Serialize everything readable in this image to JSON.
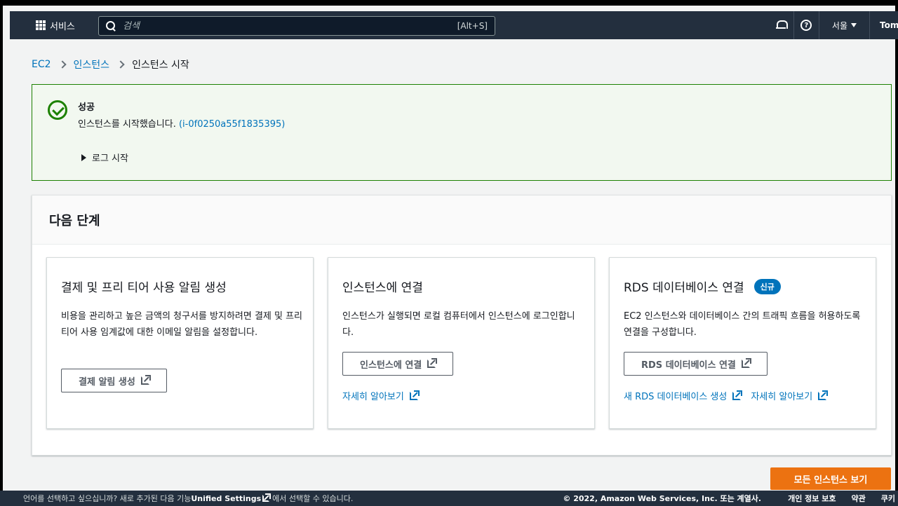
{
  "nav": {
    "services_label": "서비스",
    "search_placeholder": "검색",
    "search_shortcut": "[Alt+S]",
    "region": "서울",
    "user": "Tom"
  },
  "breadcrumb": {
    "items": [
      "EC2",
      "인스턴스",
      "인스턴스 시작"
    ]
  },
  "flash": {
    "title": "성공",
    "message": "인스턴스를 시작했습니다. ",
    "instance_link": "(i-0f0250a55f1835395)",
    "log_toggle": "로그 시작"
  },
  "next_steps": {
    "title": "다음 단계",
    "cards": [
      {
        "title": "결제 및 프리 티어 사용 알림 생성",
        "description": "비용을 관리하고 높은 금액의 청구서를 방지하려면 결제 및 프리 티어 사용 임계값에 대한 이메일 알림을 설정합니다.",
        "button": "결제 알림 생성"
      },
      {
        "title": "인스턴스에 연결",
        "description": "인스턴스가 실행되면 로컬 컴퓨터에서 인스턴스에 로그인합니다.",
        "button": "인스턴스에 연결",
        "link": "자세히 알아보기"
      },
      {
        "title": "RDS 데이터베이스 연결",
        "badge": "신규",
        "description": "EC2 인스턴스와 데이터베이스 간의 트래픽 흐름을 허용하도록 연결을 구성합니다.",
        "button": "RDS 데이터베이스 연결",
        "link": "새 RDS 데이터베이스 생성",
        "link2": "자세히 알아보기"
      }
    ]
  },
  "primary_button": "모든 인스턴스 보기",
  "footer": {
    "notice_prefix": "언어를 선택하고 싶으십니까? 새로 추가된 다음 기능",
    "notice_link": "Unified Settings",
    "notice_suffix": "에서 선택할 수 있습니다.",
    "copyright": "© 2022, Amazon Web Services, Inc. 또는 계열사.",
    "privacy": "개인 정보 보호",
    "terms": "약관",
    "cookies": "쿠키"
  }
}
